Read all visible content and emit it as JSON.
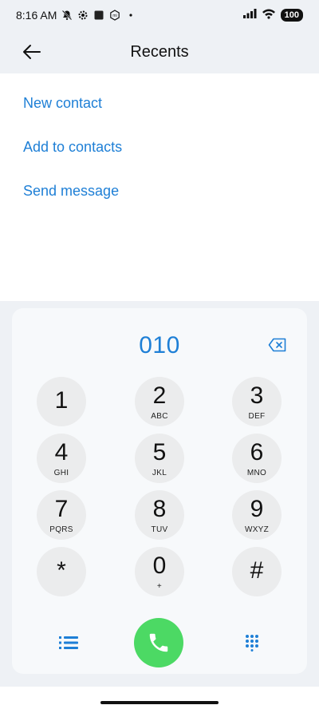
{
  "status_bar": {
    "time": "8:16 AM",
    "battery": "100",
    "icons": [
      "bell-off-icon",
      "settings-gear-icon",
      "square-icon",
      "mi-icon",
      "dot-icon",
      "signal-icon",
      "wifi-icon",
      "battery-icon"
    ]
  },
  "header": {
    "title": "Recents",
    "back_icon": "arrow-left-icon"
  },
  "actions": [
    {
      "label": "New contact"
    },
    {
      "label": "Add to contacts"
    },
    {
      "label": "Send message"
    }
  ],
  "dialpad": {
    "number": "010",
    "keys": [
      {
        "digit": "1",
        "letters": ""
      },
      {
        "digit": "2",
        "letters": "ABC"
      },
      {
        "digit": "3",
        "letters": "DEF"
      },
      {
        "digit": "4",
        "letters": "GHI"
      },
      {
        "digit": "5",
        "letters": "JKL"
      },
      {
        "digit": "6",
        "letters": "MNO"
      },
      {
        "digit": "7",
        "letters": "PQRS"
      },
      {
        "digit": "8",
        "letters": "TUV"
      },
      {
        "digit": "9",
        "letters": "WXYZ"
      },
      {
        "digit": "*",
        "letters": ""
      },
      {
        "digit": "0",
        "letters": "+"
      },
      {
        "digit": "#",
        "letters": ""
      }
    ]
  },
  "colors": {
    "accent": "#1e7fd6",
    "call": "#4cd964",
    "key_bg": "#ebeced",
    "page_bg": "#eef1f5"
  }
}
